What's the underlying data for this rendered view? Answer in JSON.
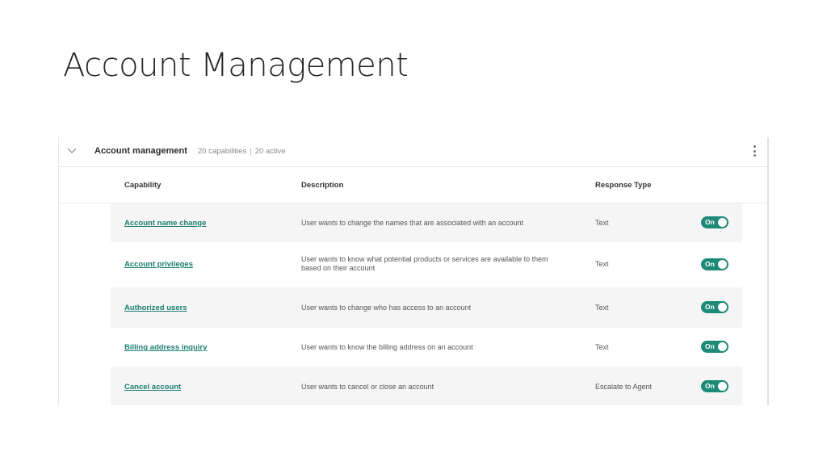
{
  "slide": {
    "title": "Account Management"
  },
  "group": {
    "title": "Account management",
    "capabilities": "20 capabilities",
    "separator": "|",
    "active": "20 active"
  },
  "columns": {
    "capability": "Capability",
    "description": "Description",
    "response_type": "Response Type"
  },
  "rows": [
    {
      "capability": "Account name change",
      "description": "User wants to change the names that are associated with an account",
      "response_type": "Text",
      "toggle": "On"
    },
    {
      "capability": "Account privileges",
      "description": "User wants to know what potential products or services are available to them based on their account",
      "response_type": "Text",
      "toggle": "On"
    },
    {
      "capability": "Authorized users",
      "description": "User wants to change who has access to an account",
      "response_type": "Text",
      "toggle": "On"
    },
    {
      "capability": "Billing address inquiry",
      "description": "User wants to know the billing address on an account",
      "response_type": "Text",
      "toggle": "On"
    },
    {
      "capability": "Cancel account",
      "description": "User wants to cancel or close an account",
      "response_type": "Escalate to Agent",
      "toggle": "On"
    }
  ],
  "colors": {
    "accent": "#1c8a76",
    "link": "#1b7f6e",
    "row_shade": "#f5f5f5"
  },
  "icons": {
    "collapse": "chevron-down-icon",
    "menu": "kebab-menu-icon"
  }
}
